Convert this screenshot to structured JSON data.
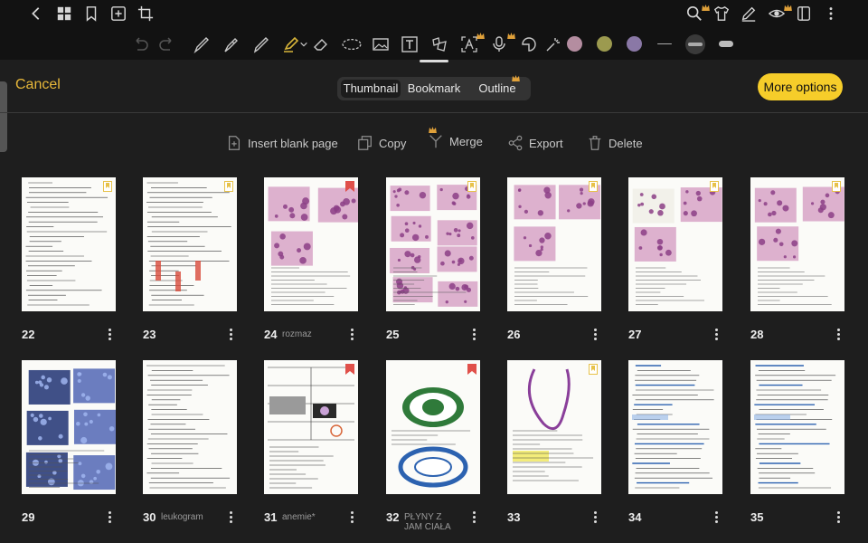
{
  "panel": {
    "cancel_label": "Cancel",
    "tabs": [
      {
        "label": "Thumbnail",
        "active": true
      },
      {
        "label": "Bookmark",
        "active": false
      },
      {
        "label": "Outline",
        "active": false
      }
    ],
    "more_options_label": "More options",
    "actions": [
      {
        "label": "Insert blank page",
        "icon": "insert-page-icon"
      },
      {
        "label": "Copy",
        "icon": "copy-icon"
      },
      {
        "label": "Merge",
        "icon": "merge-icon"
      },
      {
        "label": "Export",
        "icon": "share-icon"
      },
      {
        "label": "Delete",
        "icon": "trash-icon"
      }
    ]
  },
  "colors": {
    "accent": "#f6cd2a",
    "cancel_text": "#e8b83a",
    "swatch_pink": "#b48da0",
    "swatch_olive": "#9c9a4f",
    "swatch_purple": "#8a78a6",
    "bookmark_yellow": "#e7c24a",
    "bookmark_red": "#e0504a"
  },
  "pages": [
    {
      "number": "22",
      "label": "",
      "bookmark": "yellow",
      "kind": "text"
    },
    {
      "number": "23",
      "label": "",
      "bookmark": "yellow",
      "kind": "text-red"
    },
    {
      "number": "24",
      "label": "rozmaz",
      "bookmark": "red",
      "kind": "micro"
    },
    {
      "number": "25",
      "label": "",
      "bookmark": "yellow",
      "kind": "photos"
    },
    {
      "number": "26",
      "label": "",
      "bookmark": "yellow",
      "kind": "micro"
    },
    {
      "number": "27",
      "label": "",
      "bookmark": "yellow",
      "kind": "tubes"
    },
    {
      "number": "28",
      "label": "",
      "bookmark": "yellow",
      "kind": "cells"
    },
    {
      "number": "29",
      "label": "",
      "bookmark": "none",
      "kind": "blue-photos"
    },
    {
      "number": "30",
      "label": "leukogram",
      "bookmark": "none",
      "kind": "text"
    },
    {
      "number": "31",
      "label": "anemie*",
      "bookmark": "red",
      "kind": "table"
    },
    {
      "number": "32",
      "label": "PŁYNY Z JAM CIAŁA",
      "bookmark": "red",
      "kind": "diagram"
    },
    {
      "number": "33",
      "label": "",
      "bookmark": "yellow",
      "kind": "heart"
    },
    {
      "number": "34",
      "label": "",
      "bookmark": "none",
      "kind": "text-blue"
    },
    {
      "number": "35",
      "label": "",
      "bookmark": "none",
      "kind": "text-blue"
    }
  ]
}
